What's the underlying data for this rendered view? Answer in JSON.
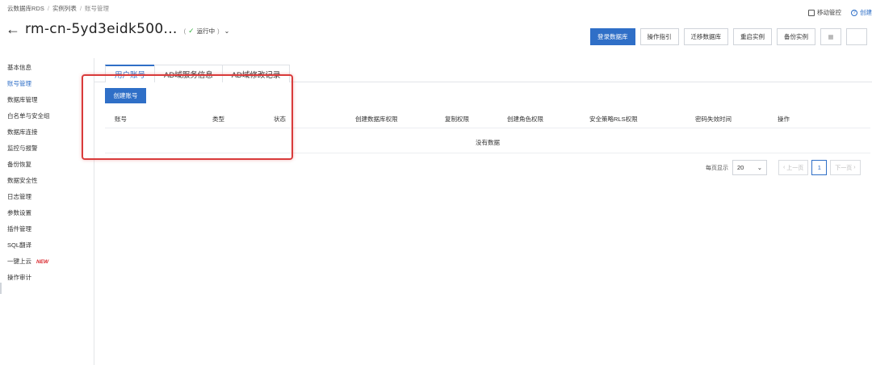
{
  "breadcrumb": [
    "云数据库RDS",
    "实例列表",
    "账号管理"
  ],
  "top_right": {
    "mobile": "移动管控",
    "create": "创建"
  },
  "title": "rm-cn-5yd3eidk500...",
  "status": {
    "open": "(",
    "text": "运行中",
    "close": ")"
  },
  "actions": [
    "登录数据库",
    "操作指引",
    "迁移数据库",
    "重启实例",
    "备份实例"
  ],
  "sidebar": {
    "items": [
      "基本信息",
      "账号管理",
      "数据库管理",
      "白名单与安全组",
      "数据库连接",
      "监控与报警",
      "备份恢复",
      "数据安全性",
      "日志管理",
      "参数设置",
      "插件管理",
      "SQL翻译",
      "一键上云",
      "操作审计"
    ],
    "new_tag": "NEW"
  },
  "tabs": [
    "用户账号",
    "AD域服务信息",
    "AD域修改记录"
  ],
  "create_button": "创建账号",
  "table": {
    "columns": [
      "账号",
      "类型",
      "状态",
      "创建数据库权限",
      "复制权限",
      "创建角色权限",
      "安全策略RLS权限",
      "密码失效时间",
      "操作"
    ],
    "empty_text": "没有数据"
  },
  "pagination": {
    "per_page_label": "每页显示",
    "per_page_value": "20",
    "prev": "上一页",
    "current": "1",
    "next": "下一页"
  },
  "colors": {
    "primary": "#2f6fc7",
    "highlight": "#d93b3b",
    "success": "#3bb346",
    "new_tag": "#d9262c"
  }
}
